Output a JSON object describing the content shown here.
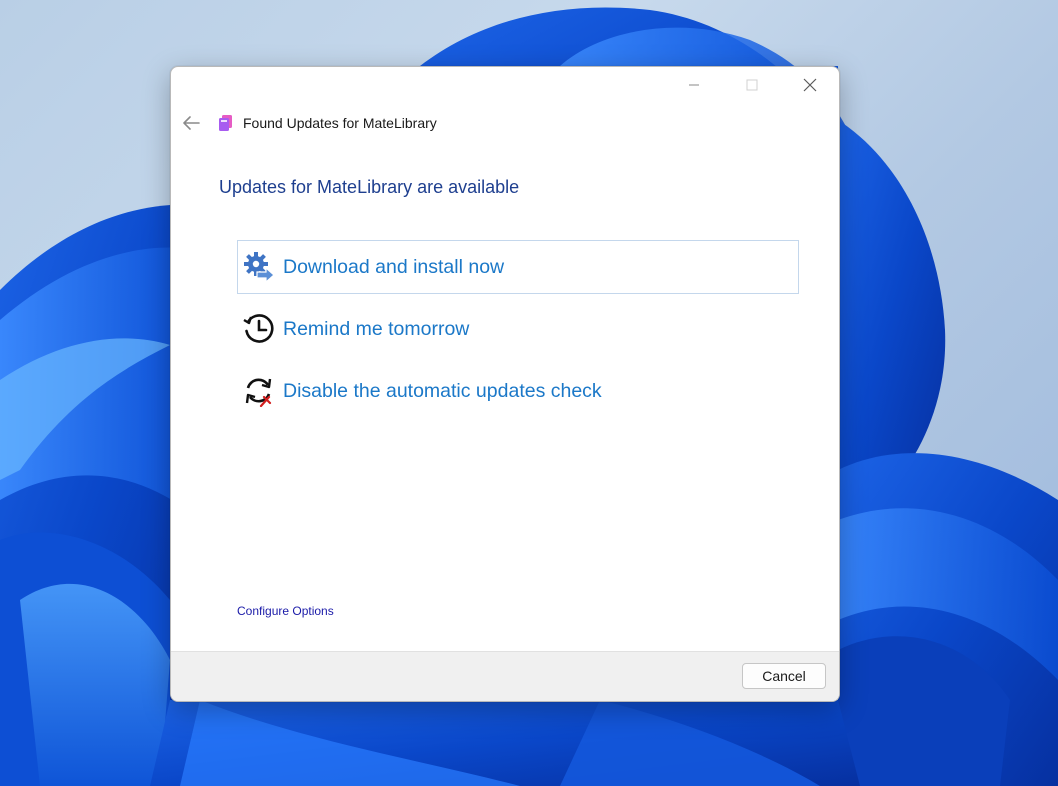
{
  "window": {
    "title": "Found Updates for MateLibrary",
    "controls": [
      "minimize-icon",
      "maximize-icon",
      "close-icon"
    ]
  },
  "dialog": {
    "heading": "Updates for MateLibrary are available",
    "options": [
      {
        "label": "Download and install now",
        "icon": "gear-arrow-icon",
        "focused": true
      },
      {
        "label": "Remind me tomorrow",
        "icon": "clock-history-icon",
        "focused": false
      },
      {
        "label": "Disable the automatic updates check",
        "icon": "sync-disabled-icon",
        "focused": false
      }
    ],
    "configure_link": "Configure Options",
    "cancel_label": "Cancel"
  },
  "colors": {
    "heading": "#1e3f8f",
    "option_text": "#1b78c8",
    "link": "#1a1aa8",
    "footer_bg": "#f0f0f0"
  }
}
